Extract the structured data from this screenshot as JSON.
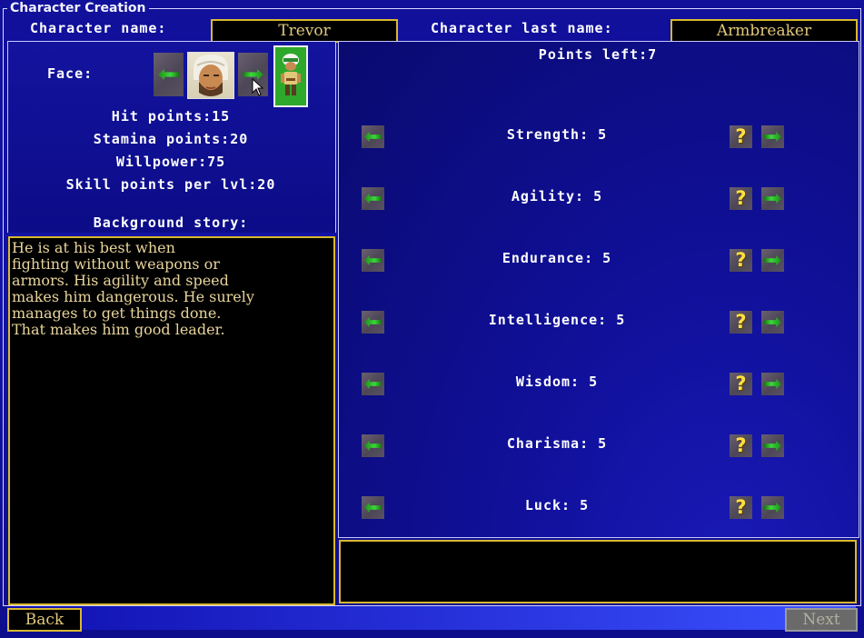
{
  "window": {
    "title": "Character Creation"
  },
  "header": {
    "first_name_label": "Character name:",
    "first_name_value": "Trevor",
    "last_name_label": "Character last name:",
    "last_name_value": "Armbreaker"
  },
  "face": {
    "label": "Face:"
  },
  "stats": {
    "hit_points": "Hit points:15",
    "stamina_points": "Stamina points:20",
    "willpower": "Willpower:75",
    "skill_points": "Skill points per lvl:20"
  },
  "background": {
    "label": "Background story:",
    "text": "He is at his best when\nfighting without weapons or\narmors. His agility and speed\nmakes him dangerous. He surely\nmanages to get things done.\nThat makes him good leader."
  },
  "points_left": "Points left:7",
  "attributes": [
    {
      "label": "Strength: 5"
    },
    {
      "label": "Agility: 5"
    },
    {
      "label": "Endurance: 5"
    },
    {
      "label": "Intelligence: 5"
    },
    {
      "label": "Wisdom: 5"
    },
    {
      "label": "Charisma: 5"
    },
    {
      "label": "Luck: 5"
    }
  ],
  "help_symbol": "?",
  "buttons": {
    "back": "Back",
    "next": "Next"
  },
  "colors": {
    "accent_border": "#d8b830",
    "name_text": "#e2c87a",
    "background": "#10109a"
  }
}
